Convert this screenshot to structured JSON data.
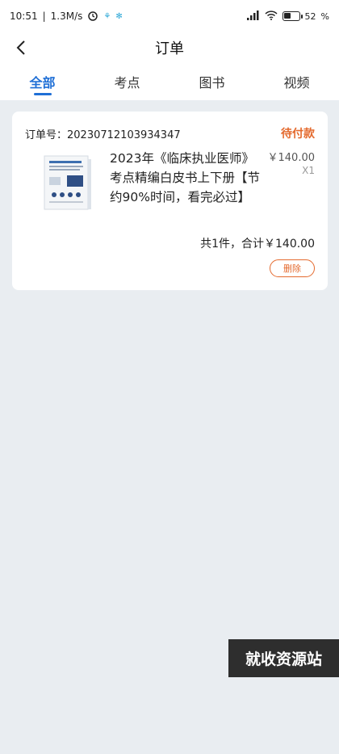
{
  "status_bar": {
    "time": "10:51",
    "speed": "1.3M/s",
    "battery": "52",
    "battery_level": 0.52
  },
  "nav": {
    "title": "订单"
  },
  "tabs": [
    {
      "label": "全部",
      "active": true
    },
    {
      "label": "考点",
      "active": false
    },
    {
      "label": "图书",
      "active": false
    },
    {
      "label": "视频",
      "active": false
    }
  ],
  "order": {
    "number_label": "订单号：",
    "number": "20230712103934347",
    "status": "待付款",
    "product": {
      "title": "2023年《临床执业医师》考点精编白皮书上下册【节约90%时间，看完必过】",
      "price": "￥140.00",
      "quantity": "X1"
    },
    "total": "共1件，合计￥140.00",
    "delete_label": "删除"
  },
  "watermark": "就收资源站",
  "colors": {
    "accent": "#1f6fd6",
    "status": "#e46a2e",
    "background": "#e9edf1"
  }
}
